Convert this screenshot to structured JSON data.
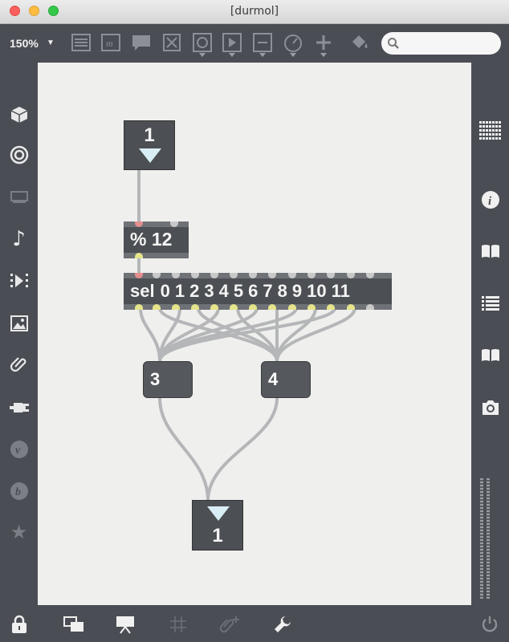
{
  "window": {
    "title": "[durmol]"
  },
  "toolbar": {
    "zoom": "150%",
    "tools": [
      "presentation-icon",
      "comment-icon",
      "message-icon",
      "toggle-icon",
      "button-icon",
      "playbar-icon",
      "slider-icon",
      "dial-icon",
      "add-object-icon",
      "paint-bucket-icon"
    ],
    "search_placeholder": ""
  },
  "sidebar_left": [
    "package-icon",
    "target-icon",
    "display-icon",
    "music-note-icon",
    "video-icon",
    "image-icon",
    "paperclip-icon",
    "plugin-icon",
    "vimeo-icon",
    "bitcoin-icon",
    "star-icon"
  ],
  "sidebar_right": [
    "grid-icon",
    "info-icon",
    "reference-icon",
    "list-icon",
    "book-icon",
    "snapshot-icon"
  ],
  "bottombar": [
    "lock-icon",
    "windows-icon",
    "presentation-mode-icon",
    "grid-icon",
    "add-attachment-icon",
    "wrench-icon",
    "power-icon"
  ],
  "patch": {
    "top_number": "1",
    "modulo_text": "% 12",
    "sel_label": "sel",
    "sel_values": [
      "0",
      "1",
      "2",
      "3",
      "4",
      "5",
      "6",
      "7",
      "8",
      "9",
      "10",
      "11"
    ],
    "msg_a": "3",
    "msg_b": "4",
    "bottom_number": "1"
  }
}
